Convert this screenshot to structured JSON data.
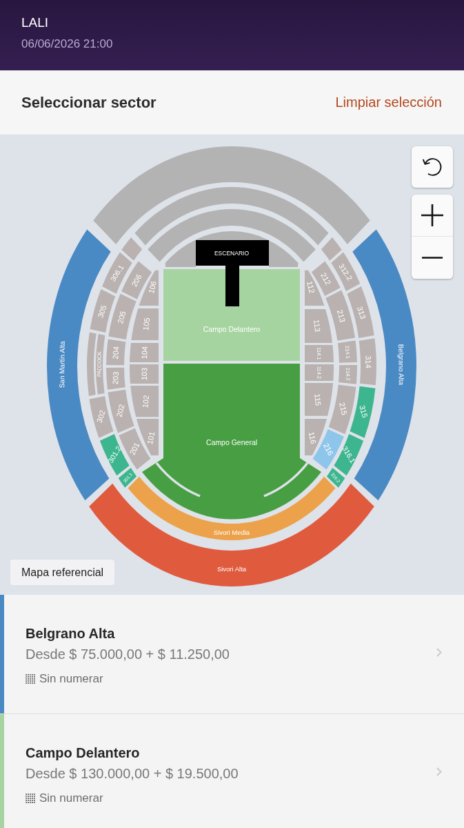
{
  "header": {
    "title": "LALI",
    "datetime": "06/06/2026 21:00"
  },
  "toolbar": {
    "title": "Seleccionar sector",
    "clear_link": "Limpiar selección"
  },
  "map": {
    "sections": [
      {
        "color": "#b3b3b3"
      },
      {
        "color": "#b3b3b3"
      },
      {
        "color": "#b3b3b3"
      },
      {
        "color": "#b3b3b3"
      },
      {
        "label": "San Martin Alta",
        "color": "#4a8ac4"
      },
      {
        "color": "#b9b2b0"
      },
      {
        "label": "306.1",
        "color": "#b9b2b0"
      },
      {
        "label": "305",
        "color": "#b9b2b0"
      },
      {
        "color": "#b9b2b0"
      },
      {
        "label": "PADDOCK",
        "color": "#b9b2b0"
      },
      {
        "label": "302",
        "color": "#b9b2b0"
      },
      {
        "label": "301.2",
        "color": "#3db58f"
      },
      {
        "label": "301.1",
        "color": "#3db58f"
      },
      {
        "label": "206",
        "color": "#b9b2b0"
      },
      {
        "label": "205",
        "color": "#b9b2b0"
      },
      {
        "label": "204",
        "color": "#b9b2b0"
      },
      {
        "label": "203",
        "color": "#b9b2b0"
      },
      {
        "label": "202",
        "color": "#b9b2b0"
      },
      {
        "label": "201",
        "color": "#b9b2b0"
      },
      {
        "label": "106",
        "color": "#b9b2b0"
      },
      {
        "label": "105",
        "color": "#b9b2b0"
      },
      {
        "label": "104",
        "color": "#b9b2b0"
      },
      {
        "label": "103",
        "color": "#b9b2b0"
      },
      {
        "label": "102",
        "color": "#b9b2b0"
      },
      {
        "label": "101",
        "color": "#b9b2b0"
      },
      {
        "label": "Campo Delantero",
        "color": "#a6d4a1"
      },
      {
        "label": "Campo General",
        "color": "#489f43"
      },
      {
        "label": "112",
        "color": "#b9b2b0"
      },
      {
        "label": "113",
        "color": "#b9b2b0"
      },
      {
        "label": "114.1",
        "color": "#b9b2b0"
      },
      {
        "label": "114.2",
        "color": "#b9b2b0"
      },
      {
        "label": "115",
        "color": "#b9b2b0"
      },
      {
        "label": "116",
        "color": "#b9b2b0"
      },
      {
        "label": "212",
        "color": "#b9b2b0"
      },
      {
        "label": "213",
        "color": "#b9b2b0"
      },
      {
        "label": "214.1",
        "color": "#b9b2b0"
      },
      {
        "label": "214.2",
        "color": "#b9b2b0"
      },
      {
        "label": "215",
        "color": "#b9b2b0"
      },
      {
        "label": "216",
        "color": "#8ec5ea"
      },
      {
        "color": "#b9b2b0"
      },
      {
        "label": "312.2",
        "color": "#b9b2b0"
      },
      {
        "label": "313",
        "color": "#b9b2b0"
      },
      {
        "label": "314",
        "color": "#b9b2b0"
      },
      {
        "label": "315",
        "color": "#3db58f"
      },
      {
        "label": "316.1",
        "color": "#3db58f"
      },
      {
        "label": "316.2",
        "color": "#3db58f"
      },
      {
        "label": "Belgrano Alta",
        "color": "#4a8ac4"
      },
      {
        "label": "Sivori Media",
        "color": "#eca24b"
      },
      {
        "label": "Sivori Alta",
        "color": "#e05a3e"
      }
    ],
    "stage": {
      "label": "ESCENARIO"
    },
    "note": "Mapa referencial"
  },
  "sectors": [
    {
      "name": "Belgrano Alta",
      "price": "Desde $ 75.000,00 + $ 11.250,00",
      "seating": "Sin numerar",
      "color": "#4a8ac4"
    },
    {
      "name": "Campo Delantero",
      "price": "Desde $ 130.000,00 + $ 19.500,00",
      "seating": "Sin numerar",
      "color": "#a6d4a1"
    }
  ]
}
